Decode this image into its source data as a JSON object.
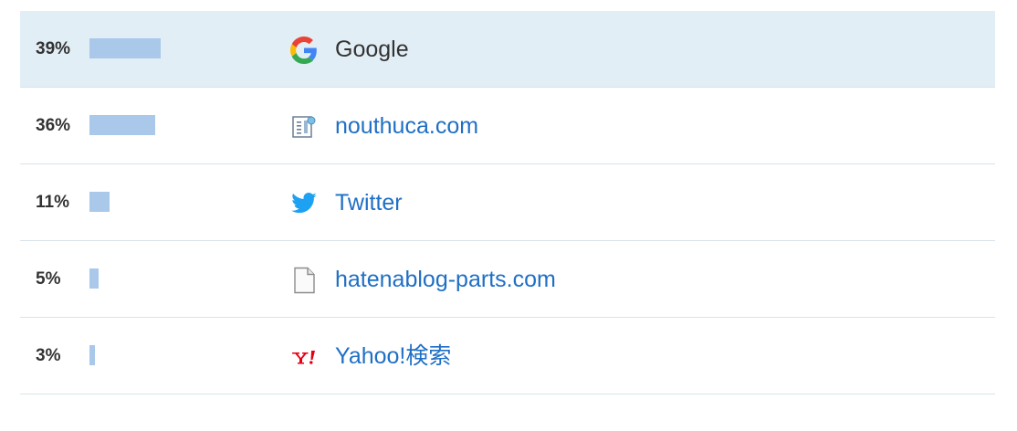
{
  "colors": {
    "bar": "#a9c8ea",
    "link": "#1f6fc5",
    "highlight_row": "#e2eef5",
    "text": "#333333"
  },
  "rows": [
    {
      "percent_label": "39%",
      "percent": 39,
      "name": "Google",
      "icon": "google-icon",
      "is_link": false
    },
    {
      "percent_label": "36%",
      "percent": 36,
      "name": "nouthuca.com",
      "icon": "site-favicon-icon",
      "is_link": true
    },
    {
      "percent_label": "11%",
      "percent": 11,
      "name": "Twitter",
      "icon": "twitter-bird-icon",
      "is_link": true
    },
    {
      "percent_label": "5%",
      "percent": 5,
      "name": "hatenablog-parts.com",
      "icon": "blank-document-icon",
      "is_link": true
    },
    {
      "percent_label": "3%",
      "percent": 3,
      "name": "Yahoo!検索",
      "icon": "yahoo-icon",
      "is_link": true
    }
  ]
}
